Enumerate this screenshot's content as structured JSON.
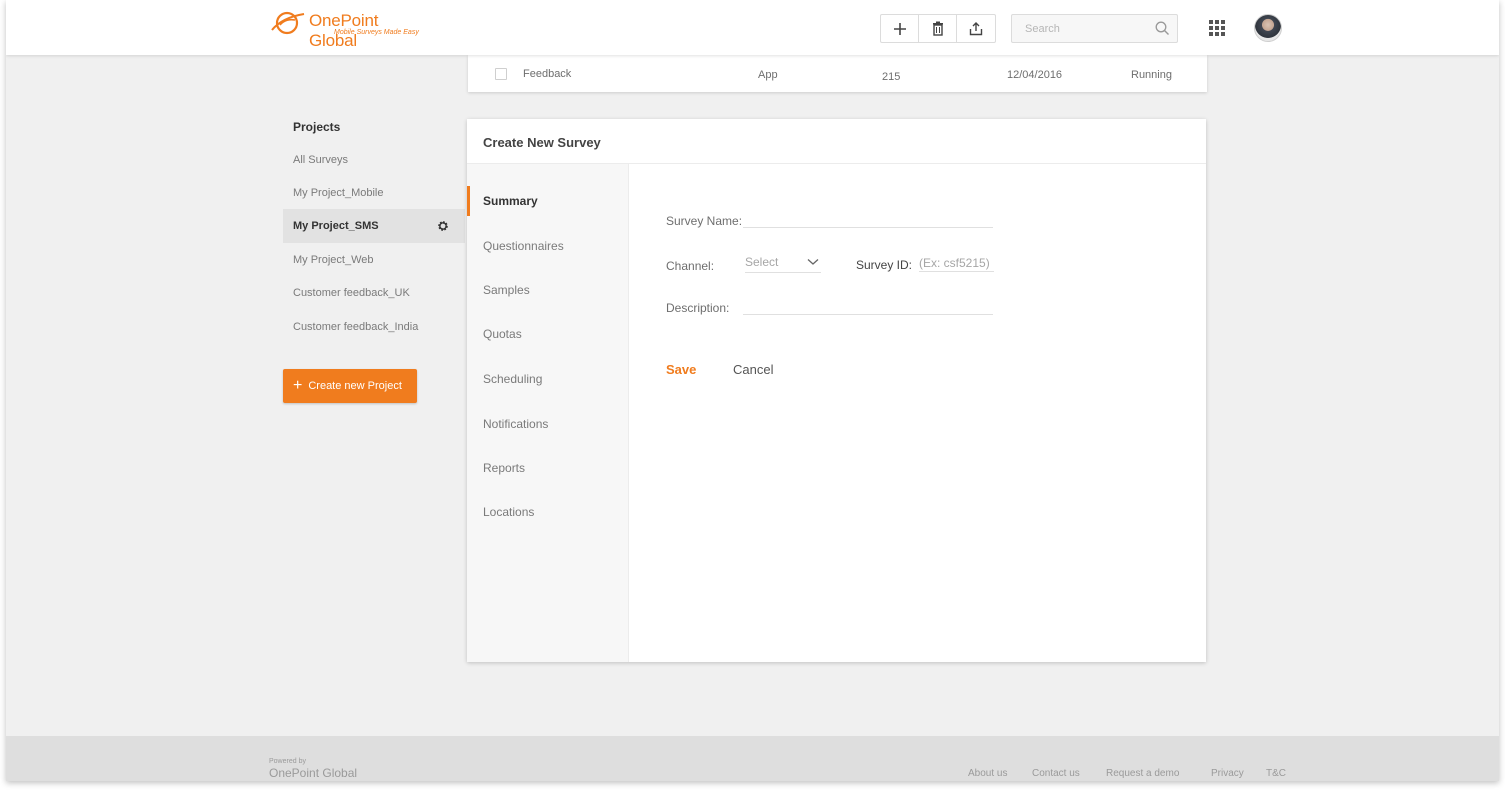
{
  "header": {
    "brand": "OnePoint Global",
    "tagline": "Mobile Surveys Made Easy",
    "tools": [
      {
        "icon": "plus-icon"
      },
      {
        "icon": "trash-icon"
      },
      {
        "icon": "upload-icon"
      }
    ],
    "search": {
      "placeholder": "Search",
      "value": ""
    },
    "apps_icon": "grid-icon",
    "avatar_icon": "user-avatar"
  },
  "background_row": {
    "name": "Feedback",
    "type": "App",
    "count": "215",
    "date": "12/04/2016",
    "status": "Running"
  },
  "sidebar": {
    "heading": "Projects",
    "items": [
      {
        "label": "All Surveys"
      },
      {
        "label": "My Project_Mobile"
      },
      {
        "label": "My Project_SMS"
      },
      {
        "label": "My Project_Web"
      },
      {
        "label": "Customer feedback_UK"
      },
      {
        "label": "Customer feedback_India"
      }
    ],
    "active_index": 2,
    "create_label": "Create new Project"
  },
  "survey_form": {
    "title": "Create New Survey",
    "steps": [
      {
        "label": "Summary"
      },
      {
        "label": "Questionnaires"
      },
      {
        "label": "Samples"
      },
      {
        "label": "Quotas"
      },
      {
        "label": "Scheduling"
      },
      {
        "label": "Notifications"
      },
      {
        "label": "Reports"
      },
      {
        "label": "Locations"
      }
    ],
    "active_step": 0,
    "survey_name_label": "Survey Name:",
    "survey_name_value": "",
    "channel_label": "Channel:",
    "channel_value": "Select",
    "survey_id_label": "Survey ID:",
    "survey_id_placeholder": "(Ex: csf5215)",
    "description_label": "Description:",
    "description_value": "",
    "save_label": "Save",
    "cancel_label": "Cancel"
  },
  "footer": {
    "powered_by": "Powered by",
    "brand": "OnePoint Global",
    "links": [
      {
        "label": "About us"
      },
      {
        "label": "Contact us"
      },
      {
        "label": "Request a demo"
      },
      {
        "label": "Privacy"
      },
      {
        "label": "T&C"
      }
    ]
  },
  "colors": {
    "accent": "#f07c1e",
    "background": "#f0f0f0",
    "footer": "#dedede"
  }
}
